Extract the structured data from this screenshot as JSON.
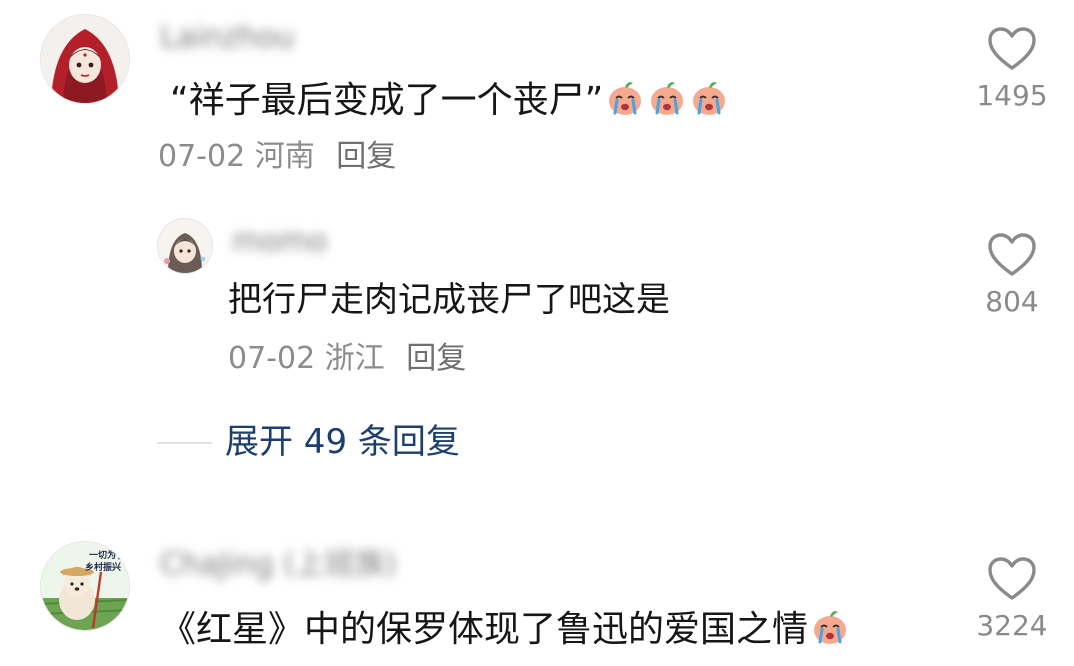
{
  "comments": [
    {
      "username": "Lainzhou",
      "text": "“祥子最后变成了一个丧尸”",
      "emoji_count": 3,
      "emoji_name": "crying-peach-emoji",
      "date": "07-02",
      "location": "河南",
      "reply_label": "回复",
      "likes": "1495",
      "avatar_icon": "red-hood-girl-avatar-icon"
    },
    {
      "username": "ChaJing (上班族)",
      "text": "《红星》中的保罗体现了鲁迅的爱国之情",
      "emoji_count": 1,
      "emoji_name": "crying-peach-emoji",
      "avatar_text_top": "一切为了",
      "avatar_text_bottom": "乡村振兴",
      "likes": "3224",
      "avatar_icon": "dog-farmer-avatar-icon"
    }
  ],
  "reply": {
    "username": "momo",
    "text": "把行尸走肉记成丧尸了吧这是",
    "date": "07-02",
    "location": "浙江",
    "reply_label": "回复",
    "likes": "804",
    "avatar_icon": "anime-girl-avatar-icon"
  },
  "expand": {
    "label": "展开 49 条回复"
  },
  "colors": {
    "text": "#161616",
    "meta": "#8c8c8c",
    "link": "#1c3f6e",
    "like_icon": "#8a8a8a"
  }
}
